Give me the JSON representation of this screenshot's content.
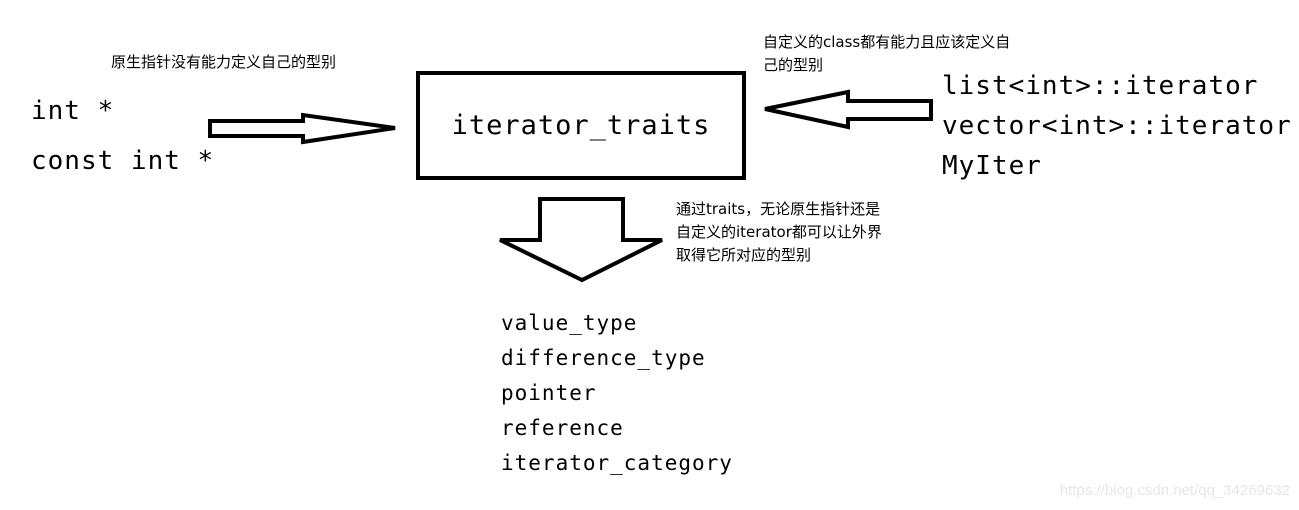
{
  "diagram": {
    "title": "iterator_traits",
    "left": {
      "note": "原生指针没有能力定义自己的型别",
      "items": [
        "int *",
        "const int *"
      ]
    },
    "right": {
      "note_lines": [
        "自定义的class都有能力且应该定义自",
        "己的型别"
      ],
      "items": [
        "list<int>::iterator",
        "vector<int>::iterator",
        "MyIter"
      ]
    },
    "bottom": {
      "note_lines": [
        "通过traits，无论原生指针还是",
        "自定义的iterator都可以让外界",
        "取得它所对应的型别"
      ],
      "items": [
        "value_type",
        "difference_type",
        "pointer",
        "reference",
        "iterator_category"
      ]
    },
    "arrows": [
      {
        "from": "left.items",
        "to": "title",
        "direction": "right"
      },
      {
        "from": "right.items",
        "to": "title",
        "direction": "left"
      },
      {
        "from": "title",
        "to": "bottom.items",
        "direction": "down"
      }
    ]
  },
  "watermark": "https://blog.csdn.net/qq_34269632"
}
